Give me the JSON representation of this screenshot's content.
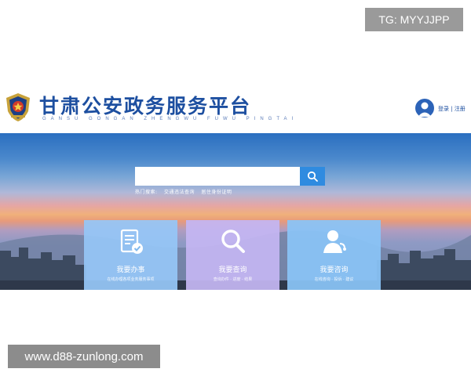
{
  "watermarks": {
    "top": "TG: MYYJJPP",
    "bottom": "www.d88-zunlong.com"
  },
  "header": {
    "title": "甘肃公安政务服务平台",
    "pinyin": "GANSU GONGAN ZHENGWU FUWU PINGTAI",
    "auth": "登录 | 注册",
    "emblem_icon": "police-emblem-icon",
    "avatar_icon": "user-avatar-icon",
    "brand_color": "#1d4fa0"
  },
  "search": {
    "value": "",
    "button_icon": "search-icon",
    "hot_label": "热门搜索:",
    "hot_items": [
      "交通违法查询",
      "居住身份证明"
    ],
    "button_color": "#2f8be0"
  },
  "cards": [
    {
      "title": "我要办事",
      "desc": "在线办理各项业务服务事项",
      "icon": "document-check-icon"
    },
    {
      "title": "我要查询",
      "desc": "查询办件 · 进度 · 结果",
      "icon": "magnifier-icon"
    },
    {
      "title": "我要咨询",
      "desc": "在线咨询 · 投诉 · 建议",
      "icon": "customer-service-icon"
    }
  ]
}
